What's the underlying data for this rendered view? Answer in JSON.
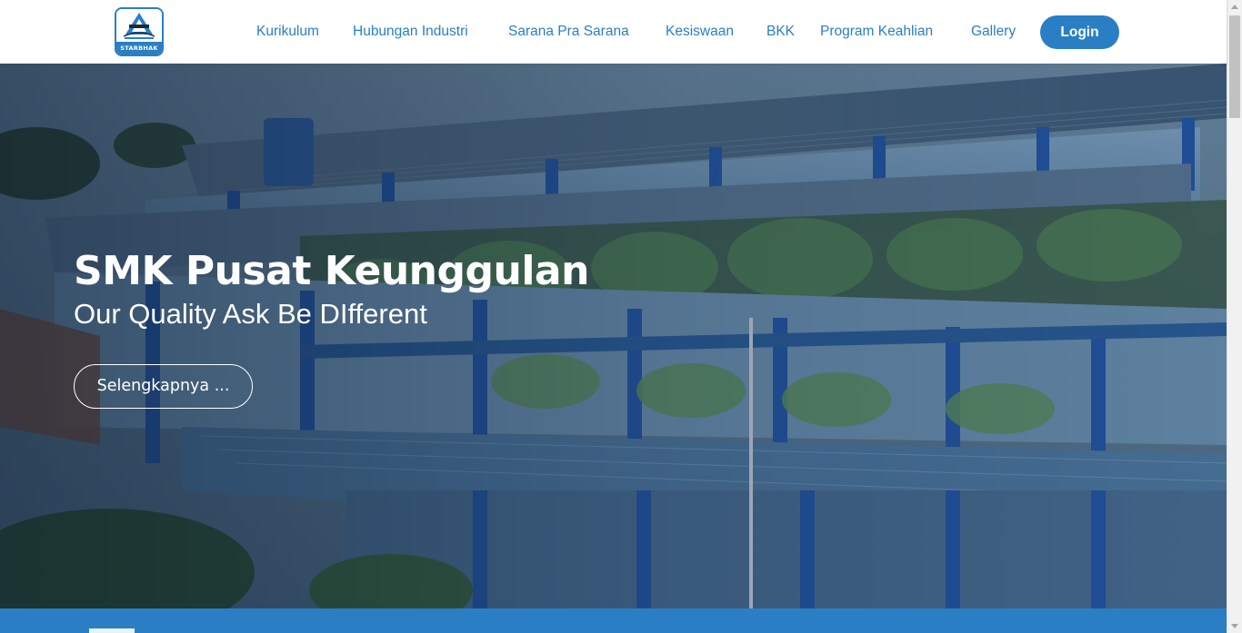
{
  "brand": {
    "logo_text": "STARBHAK",
    "primary_color": "#2a7fc4"
  },
  "nav": {
    "items": [
      {
        "label": "Kurikulum"
      },
      {
        "label": "Hubungan Industri"
      },
      {
        "label": "Sarana Pra Sarana"
      },
      {
        "label": "Kesiswaan"
      },
      {
        "label": "BKK"
      },
      {
        "label": "Program Keahlian"
      },
      {
        "label": "Gallery"
      }
    ],
    "login_label": "Login"
  },
  "hero": {
    "title": "SMK Pusat Keunggulan",
    "subtitle": "Our Quality Ask Be DIfferent",
    "cta_label": "Selengkapnya ...",
    "image_icon": "school-building-photo"
  }
}
